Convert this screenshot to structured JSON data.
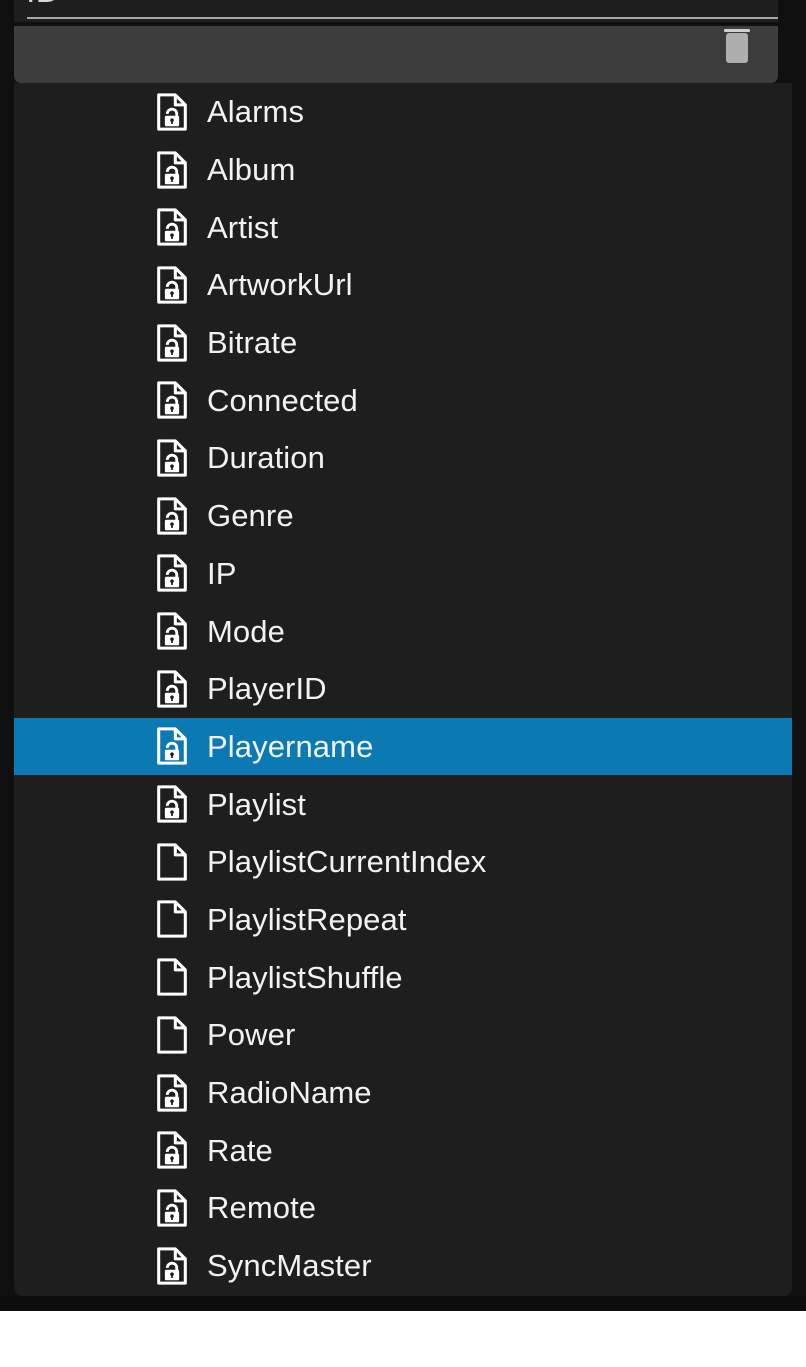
{
  "window": {
    "background_color": "#101010",
    "panel_color": "#1e1e1e",
    "header_panel_color": "#3c3c3c",
    "accent_color": "#0b7ab3",
    "text_color": "#f2f2f2",
    "cut_off_top_text": "ID"
  },
  "header": {
    "scrollbar_name": "vertical-scrollbar",
    "scrollbar_thumb_color": "#aeaeae"
  },
  "list": {
    "selected_label": "Playername",
    "items": [
      {
        "label": "Alarms",
        "icon": "document-lock-icon",
        "locked": true,
        "selected": false
      },
      {
        "label": "Album",
        "icon": "document-lock-icon",
        "locked": true,
        "selected": false
      },
      {
        "label": "Artist",
        "icon": "document-lock-icon",
        "locked": true,
        "selected": false
      },
      {
        "label": "ArtworkUrl",
        "icon": "document-lock-icon",
        "locked": true,
        "selected": false
      },
      {
        "label": "Bitrate",
        "icon": "document-lock-icon",
        "locked": true,
        "selected": false
      },
      {
        "label": "Connected",
        "icon": "document-lock-icon",
        "locked": true,
        "selected": false
      },
      {
        "label": "Duration",
        "icon": "document-lock-icon",
        "locked": true,
        "selected": false
      },
      {
        "label": "Genre",
        "icon": "document-lock-icon",
        "locked": true,
        "selected": false
      },
      {
        "label": "IP",
        "icon": "document-lock-icon",
        "locked": true,
        "selected": false
      },
      {
        "label": "Mode",
        "icon": "document-lock-icon",
        "locked": true,
        "selected": false
      },
      {
        "label": "PlayerID",
        "icon": "document-lock-icon",
        "locked": true,
        "selected": false
      },
      {
        "label": "Playername",
        "icon": "document-lock-icon",
        "locked": true,
        "selected": true
      },
      {
        "label": "Playlist",
        "icon": "document-lock-icon",
        "locked": true,
        "selected": false
      },
      {
        "label": "PlaylistCurrentIndex",
        "icon": "document-icon",
        "locked": false,
        "selected": false
      },
      {
        "label": "PlaylistRepeat",
        "icon": "document-icon",
        "locked": false,
        "selected": false
      },
      {
        "label": "PlaylistShuffle",
        "icon": "document-icon",
        "locked": false,
        "selected": false
      },
      {
        "label": "Power",
        "icon": "document-icon",
        "locked": false,
        "selected": false
      },
      {
        "label": "RadioName",
        "icon": "document-lock-icon",
        "locked": true,
        "selected": false
      },
      {
        "label": "Rate",
        "icon": "document-lock-icon",
        "locked": true,
        "selected": false
      },
      {
        "label": "Remote",
        "icon": "document-lock-icon",
        "locked": true,
        "selected": false
      },
      {
        "label": "SyncMaster",
        "icon": "document-lock-icon",
        "locked": true,
        "selected": false
      },
      {
        "label": "",
        "icon": "document-lock-icon",
        "locked": true,
        "selected": false,
        "partial": true
      }
    ]
  }
}
